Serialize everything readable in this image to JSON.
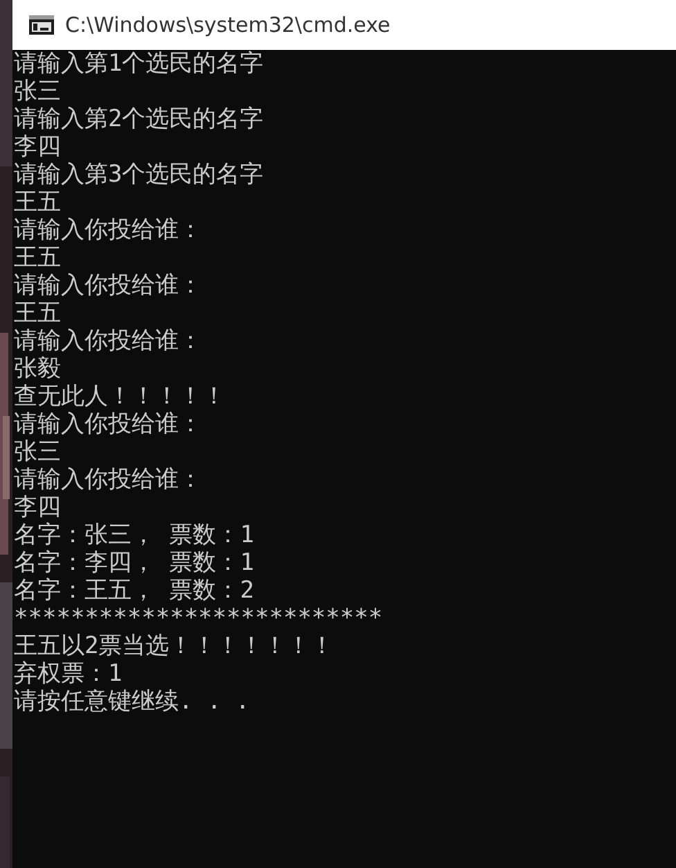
{
  "window": {
    "title": "C:\\Windows\\system32\\cmd.exe"
  },
  "console_lines": [
    "请输入第1个选民的名字",
    "张三",
    "请输入第2个选民的名字",
    "李四",
    "请输入第3个选民的名字",
    "王五",
    "请输入你投给谁：",
    "王五",
    "请输入你投给谁：",
    "王五",
    "请输入你投给谁：",
    "张毅",
    "查无此人！！！！！",
    "请输入你投给谁：",
    "张三",
    "请输入你投给谁：",
    "李四",
    "名字：张三， 票数：1",
    "名字：李四， 票数：1",
    "名字：王五， 票数：2",
    "**************************",
    "王五以2票当选！！！！！！！",
    "弃权票：1",
    "请按任意键继续. . ."
  ]
}
